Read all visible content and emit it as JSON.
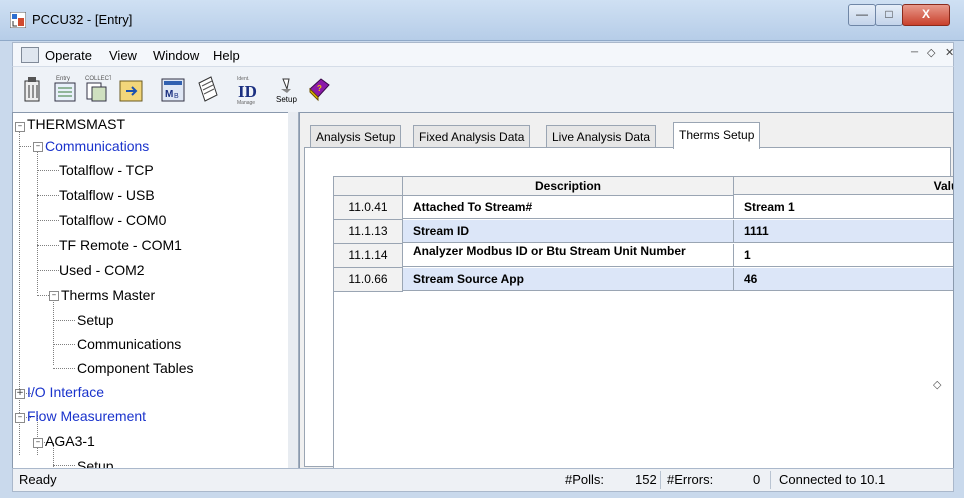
{
  "window": {
    "title": "PCCU32 - [Entry]"
  },
  "menu": {
    "items": [
      "Operate",
      "View",
      "Window",
      "Help"
    ]
  },
  "toolbar": {
    "buttons": [
      "exit-icon",
      "entry-icon",
      "collect-icon",
      "refresh-icon",
      "modbus-icon",
      "notes-icon",
      "id-icon",
      "setup-icon",
      "help-book-icon"
    ],
    "setup_label": "Setup"
  },
  "tree": {
    "root": "THERMSMAST",
    "communications": "Communications",
    "totalflow_tcp": "Totalflow - TCP",
    "totalflow_usb": "Totalflow - USB",
    "totalflow_com0": "Totalflow - COM0",
    "tf_remote_com1": "TF Remote - COM1",
    "used_com2": "Used - COM2",
    "therms_master": "Therms Master",
    "setup": "Setup",
    "communications_sub": "Communications",
    "component_tables": "Component Tables",
    "io_interface": "I/O Interface",
    "flow_measurement": "Flow Measurement",
    "aga3_1": "AGA3-1",
    "setup_2": "Setup"
  },
  "tabs": [
    "Analysis Setup",
    "Fixed Analysis Data",
    "Live Analysis Data",
    "Therms Setup"
  ],
  "active_tab": "Therms Setup",
  "grid": {
    "headers": {
      "description": "Description",
      "value": "Value"
    },
    "rows": [
      {
        "id": "11.0.41",
        "description": "Attached To Stream#",
        "value": "Stream 1"
      },
      {
        "id": "11.1.13",
        "description": "Stream ID",
        "value": "1111"
      },
      {
        "id": "11.1.14",
        "description": "Analyzer Modbus ID or Btu Stream Unit Number",
        "value": "1"
      },
      {
        "id": "11.0.66",
        "description": "Stream Source App",
        "value": "46"
      }
    ]
  },
  "status": {
    "ready": "Ready",
    "polls_label": "#Polls:",
    "polls_value": "152",
    "errors_label": "#Errors:",
    "errors_value": "0",
    "connection": "Connected to 10.1"
  },
  "colors": {
    "tree_link": "#1a33cc",
    "selected_row": "#dce6f8",
    "close_button": "#c9412d"
  }
}
